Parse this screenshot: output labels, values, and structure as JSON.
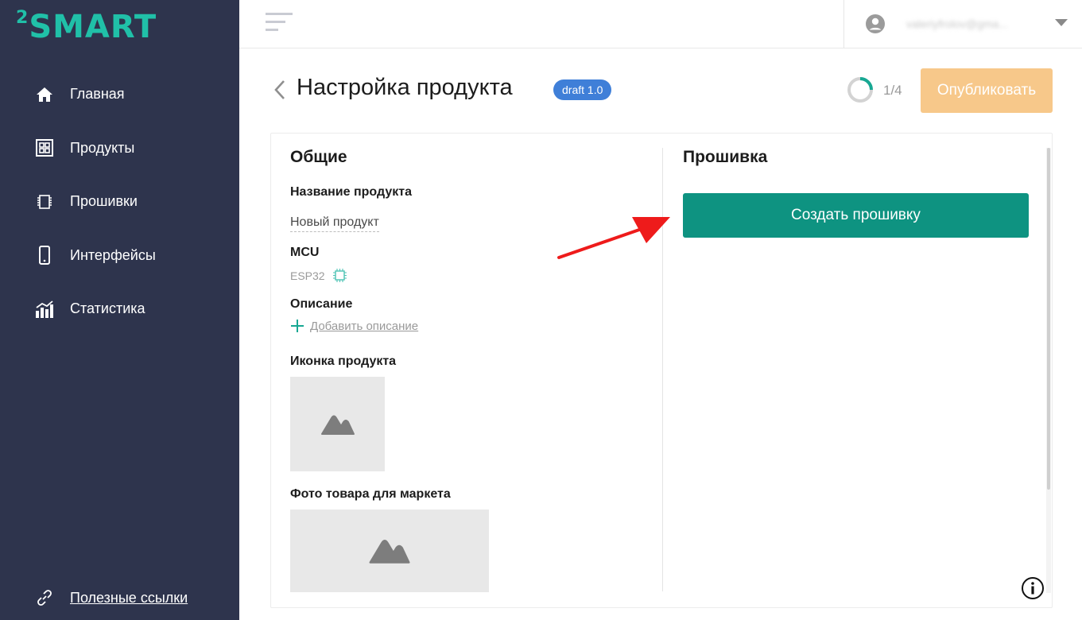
{
  "app": {
    "logo_sup": "2",
    "logo_text": "SMART",
    "accent": "#20c0a8",
    "sidebar_bg": "#2e344d"
  },
  "sidebar": {
    "items": [
      {
        "label": "Главная",
        "icon": "home-icon"
      },
      {
        "label": "Продукты",
        "icon": "products-icon"
      },
      {
        "label": "Прошивки",
        "icon": "chip-icon"
      },
      {
        "label": "Интерфейсы",
        "icon": "phone-icon"
      },
      {
        "label": "Статистика",
        "icon": "stats-icon"
      }
    ],
    "links_label": "Полезные ссылки"
  },
  "topbar": {
    "user_email": "valeriyfrolov@gma..."
  },
  "header": {
    "title": "Настройка продукта",
    "badge": "draft 1.0",
    "step": "1/4",
    "step_progress": 0.25,
    "publish_label": "Опубликовать",
    "publish_color": "#f7c88a"
  },
  "general": {
    "heading": "Общие",
    "name_label": "Название продукта",
    "name_value": "Новый продукт",
    "mcu_label": "MCU",
    "mcu_value": "ESP32",
    "desc_label": "Описание",
    "add_desc": "Добавить описание",
    "icon_label": "Иконка продукта",
    "photo_label": "Фото товара для маркета"
  },
  "firmware": {
    "heading": "Прошивка",
    "create_label": "Создать прошивку",
    "button_color": "#0e9381"
  }
}
